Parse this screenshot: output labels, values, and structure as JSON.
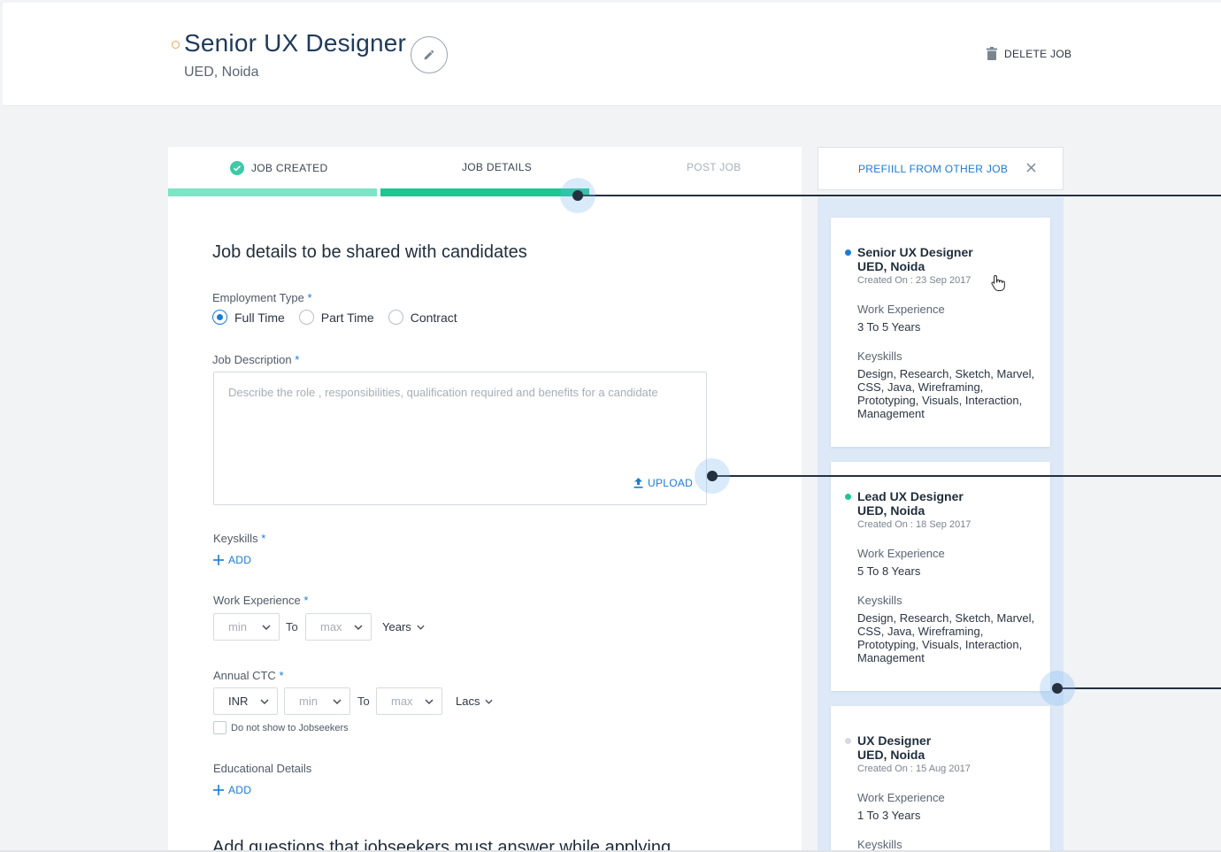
{
  "header": {
    "title": "Senior UX Designer",
    "subtitle": "UED, Noida",
    "delete_label": "DELETE JOB"
  },
  "steps": [
    {
      "label": "JOB CREATED",
      "state": "done"
    },
    {
      "label": "JOB DETAILS",
      "state": "active"
    },
    {
      "label": "POST JOB",
      "state": "pending"
    }
  ],
  "form": {
    "section_title": "Job details to be shared with candidates",
    "employment_type": {
      "label": "Employment Type",
      "required": "*",
      "options": [
        "Full Time",
        "Part Time",
        "Contract"
      ],
      "selected": "Full Time"
    },
    "job_description": {
      "label": "Job Description",
      "required": "*",
      "placeholder": "Describe the role , responsibilities, qualification required and benefits for a candidate",
      "upload_label": "UPLOAD"
    },
    "keyskills": {
      "label": "Keyskills",
      "required": "*",
      "add_label": "ADD"
    },
    "work_experience": {
      "label": "Work Experience",
      "required": "*",
      "min_placeholder": "min",
      "to_label": "To",
      "max_placeholder": "max",
      "unit": "Years"
    },
    "annual_ctc": {
      "label": "Annual CTC",
      "required": "*",
      "currency": "INR",
      "min_placeholder": "min",
      "to_label": "To",
      "max_placeholder": "max",
      "unit": "Lacs",
      "hide_label": "Do not show to Jobseekers"
    },
    "educational_details": {
      "label": "Educational Details",
      "add_label": "ADD"
    },
    "questions_heading": "Add questions that jobseekers must answer while applying"
  },
  "prefill": {
    "header_label": "PREFIILL FROM OTHER JOB",
    "jobs": [
      {
        "title": "Senior UX Designer",
        "location": "UED, Noida",
        "created": "Created On : 23 Sep 2017",
        "dot_color": "#1b7ad9",
        "experience_label": "Work Experience",
        "experience": "3 To 5 Years",
        "keyskills_label": "Keyskills",
        "keyskills": "Design, Research, Sketch, Marvel, CSS, Java, Wireframing, Prototyping, Visuals, Interaction, Management"
      },
      {
        "title": "Lead UX Designer",
        "location": "UED, Noida",
        "created": "Created On : 18 Sep 2017",
        "dot_color": "#19c98f",
        "experience_label": "Work Experience",
        "experience": "5 To 8 Years",
        "keyskills_label": "Keyskills",
        "keyskills": "Design, Research, Sketch, Marvel, CSS, Java, Wireframing, Prototyping, Visuals, Interaction, Management"
      },
      {
        "title": "UX Designer",
        "location": "UED, Noida",
        "created": "Created On : 15 Aug 2017",
        "dot_color": "#d5d8e6",
        "experience_label": "Work Experience",
        "experience": "1 To 3 Years",
        "keyskills_label": "Keyskills",
        "keyskills": ""
      }
    ]
  },
  "colors": {
    "accent": "#1b7ad9",
    "progress_done": "#7fe3c5",
    "progress_active": "#19c98f",
    "panel_bg": "#dde9f7"
  }
}
